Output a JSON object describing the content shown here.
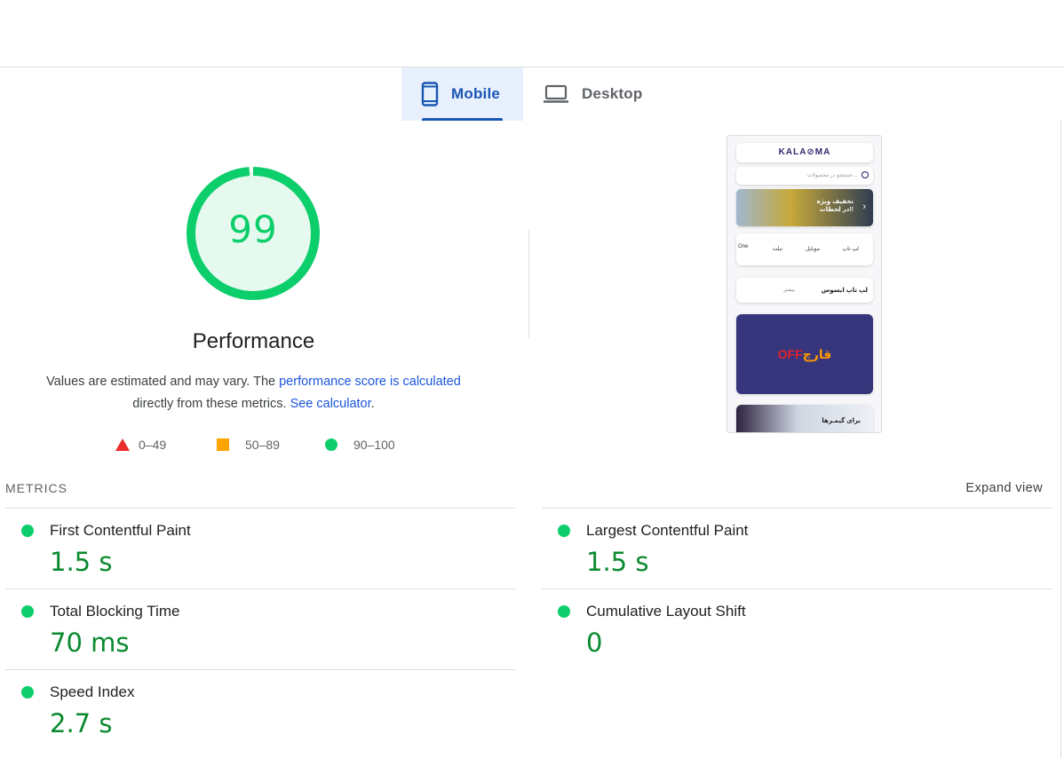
{
  "tabs": [
    {
      "label": "Mobile",
      "icon": "phone-icon",
      "active": true
    },
    {
      "label": "Desktop",
      "icon": "laptop-icon",
      "active": false
    }
  ],
  "score": {
    "value": "99",
    "gauge_fraction": 0.99,
    "title": "Performance",
    "desc_text1": "Values are estimated and may vary. The ",
    "desc_link1": "performance score is calculated",
    "desc_text2": "directly from these metrics. ",
    "desc_link2": "See calculator",
    "desc_text3": "."
  },
  "legend": {
    "fail": "0–49",
    "average": "50–89",
    "pass": "90–100"
  },
  "colors": {
    "pass": "#0cce6b",
    "average": "#ffa400",
    "fail": "#eb2b2b",
    "accent": "#1a56b3",
    "metric_value": "#0a8a2e"
  },
  "preview": {
    "logo": "KALA⊘MA",
    "search_placeholder": "جستجو در محصولات...",
    "banner_text1": "تخفیف ویژه",
    "banner_text2": "در لحظات!!",
    "categories": [
      "لپ تاپ",
      "موبایل",
      "تبلت",
      "One"
    ],
    "row_title": "لپ تاپ ایسوس",
    "row_more": "بیشتر",
    "promo_off": "OFF",
    "promo_word": "قارچ",
    "bottom_text": "برای گیمـرها"
  },
  "metrics": {
    "heading": "METRICS",
    "expand": "Expand view",
    "items": [
      {
        "name": "First Contentful Paint",
        "value": "1.5 s",
        "status": "pass"
      },
      {
        "name": "Largest Contentful Paint",
        "value": "1.5 s",
        "status": "pass"
      },
      {
        "name": "Total Blocking Time",
        "value": "70 ms",
        "status": "pass"
      },
      {
        "name": "Cumulative Layout Shift",
        "value": "0",
        "status": "pass"
      },
      {
        "name": "Speed Index",
        "value": "2.7 s",
        "status": "pass"
      }
    ]
  }
}
